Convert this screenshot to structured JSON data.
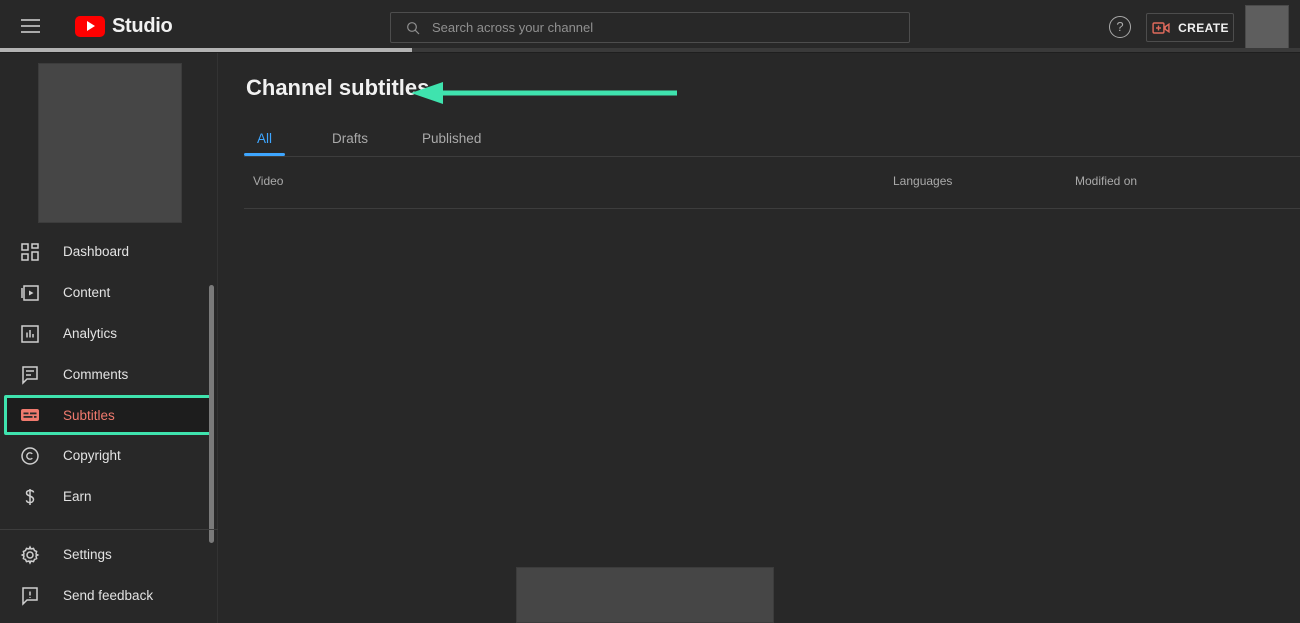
{
  "header": {
    "menu_icon": "hamburger-icon",
    "logo_text": "Studio",
    "logo_icon": "youtube-play-icon",
    "search": {
      "icon": "search-icon",
      "placeholder": "Search across your channel",
      "value": ""
    },
    "help_icon": "question-mark-icon",
    "help_label": "?",
    "create_label": "CREATE",
    "create_icon": "video-plus-icon",
    "avatar": "account-avatar"
  },
  "loading": {
    "progress_percent": 32
  },
  "sidebar": {
    "avatar": "channel-avatar-placeholder",
    "items": [
      {
        "label": "Dashboard",
        "icon": "dashboard-icon",
        "active": false
      },
      {
        "label": "Content",
        "icon": "content-video-icon",
        "active": false
      },
      {
        "label": "Analytics",
        "icon": "analytics-bar-chart-icon",
        "active": false
      },
      {
        "label": "Comments",
        "icon": "comments-speech-bubble-icon",
        "active": false
      },
      {
        "label": "Subtitles",
        "icon": "subtitles-caption-icon",
        "active": true
      },
      {
        "label": "Copyright",
        "icon": "copyright-icon",
        "active": false
      },
      {
        "label": "Earn",
        "icon": "dollar-sign-icon",
        "active": false
      }
    ],
    "bottom_items": [
      {
        "label": "Settings",
        "icon": "gear-icon"
      },
      {
        "label": "Send feedback",
        "icon": "feedback-flag-icon"
      }
    ]
  },
  "main": {
    "title": "Channel subtitles",
    "tabs": [
      {
        "label": "All",
        "active": true
      },
      {
        "label": "Drafts",
        "active": false
      },
      {
        "label": "Published",
        "active": false
      }
    ],
    "table": {
      "columns": [
        "Video",
        "Languages",
        "Modified on"
      ],
      "rows": []
    }
  },
  "annotations": {
    "arrow": {
      "name": "highlight-arrow-to-title",
      "direction": "left",
      "color": "#3fe3ae"
    },
    "highlight_box": {
      "name": "highlight-box-subtitles-nav",
      "target": "Subtitles",
      "color": "#3fe3ae"
    }
  },
  "colors": {
    "background": "#282828",
    "accent_blue": "#3ea6ff",
    "accent_red": "#ff0000",
    "annotation_teal": "#3fe3ae",
    "active_nav_text": "#f07a6e",
    "muted_text": "#aaaaaa"
  }
}
